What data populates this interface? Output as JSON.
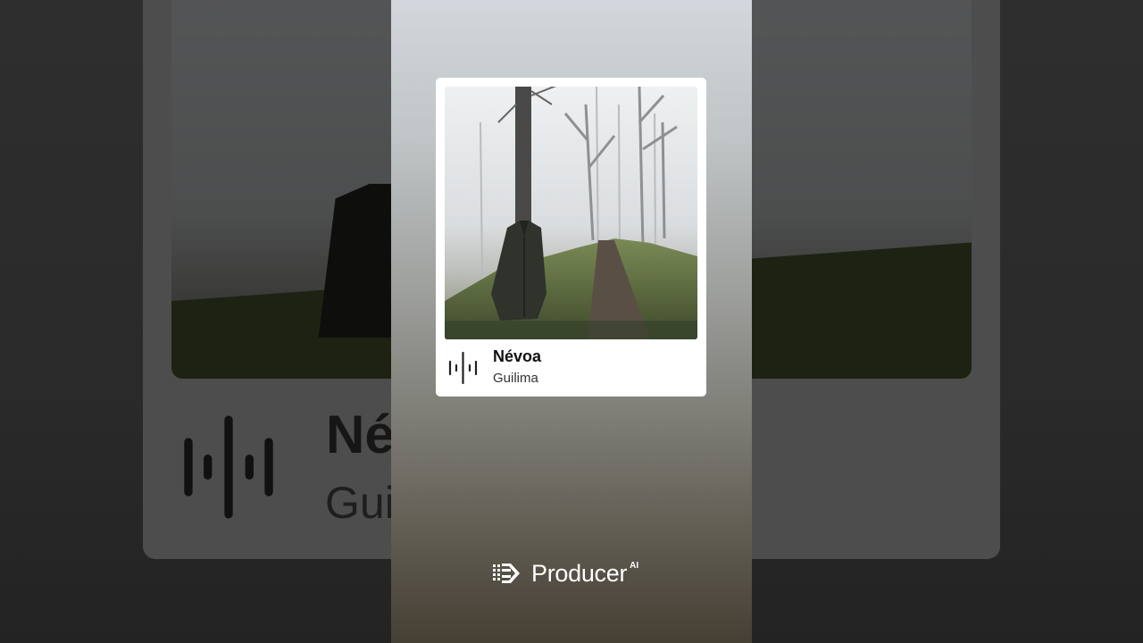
{
  "track": {
    "title": "Névoa",
    "artist": "Guilima"
  },
  "background": {
    "title_partial": "Né",
    "artist_partial": "Gui"
  },
  "brand": {
    "name": "Producer",
    "suffix": "AI"
  },
  "icons": {
    "waveform": "waveform-icon",
    "brand_logo": "producer-logo-icon"
  },
  "colors": {
    "card": "#ffffff",
    "title": "#111111",
    "brand_text": "#ffffff"
  }
}
